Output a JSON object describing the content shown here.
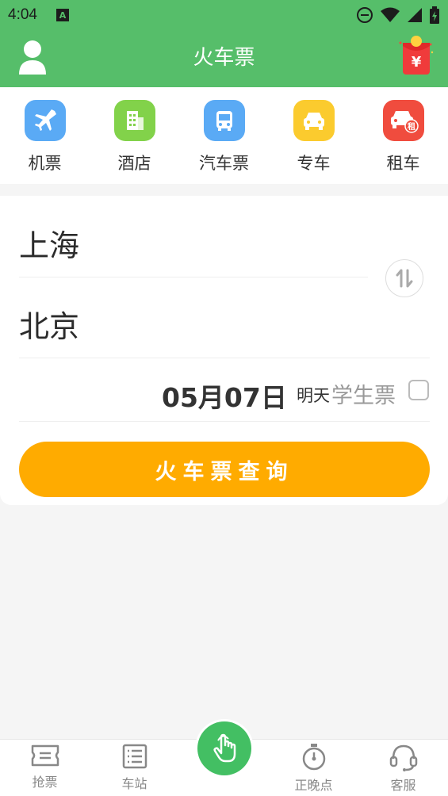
{
  "status": {
    "time": "4:04",
    "badge": "A"
  },
  "header": {
    "title": "火车票"
  },
  "services": [
    {
      "label": "机票",
      "icon": "airplane-icon",
      "color": "#5aaaf5"
    },
    {
      "label": "酒店",
      "icon": "building-icon",
      "color": "#82d24a"
    },
    {
      "label": "汽车票",
      "icon": "bus-icon",
      "color": "#5aaaf5"
    },
    {
      "label": "专车",
      "icon": "car-icon",
      "color": "#fbcb2e"
    },
    {
      "label": "租车",
      "icon": "rental-car-icon",
      "color": "#f04c3e",
      "badge": "租"
    }
  ],
  "search": {
    "from_city": "上海",
    "to_city": "北京",
    "date": "05月07日",
    "date_sub": "明天",
    "student_label": "学生票",
    "button_label": "火车票查询"
  },
  "redpacket": {
    "symbol": "¥"
  },
  "tabbar": [
    {
      "label": "抢票",
      "icon": "ticket-icon"
    },
    {
      "label": "车站",
      "icon": "list-icon"
    },
    {
      "label": "",
      "icon": "tap-hand-icon"
    },
    {
      "label": "正晚点",
      "icon": "stopwatch-icon"
    },
    {
      "label": "客服",
      "icon": "headset-icon"
    }
  ],
  "colors": {
    "brand": "#56be6a",
    "accent": "#ffab00"
  }
}
